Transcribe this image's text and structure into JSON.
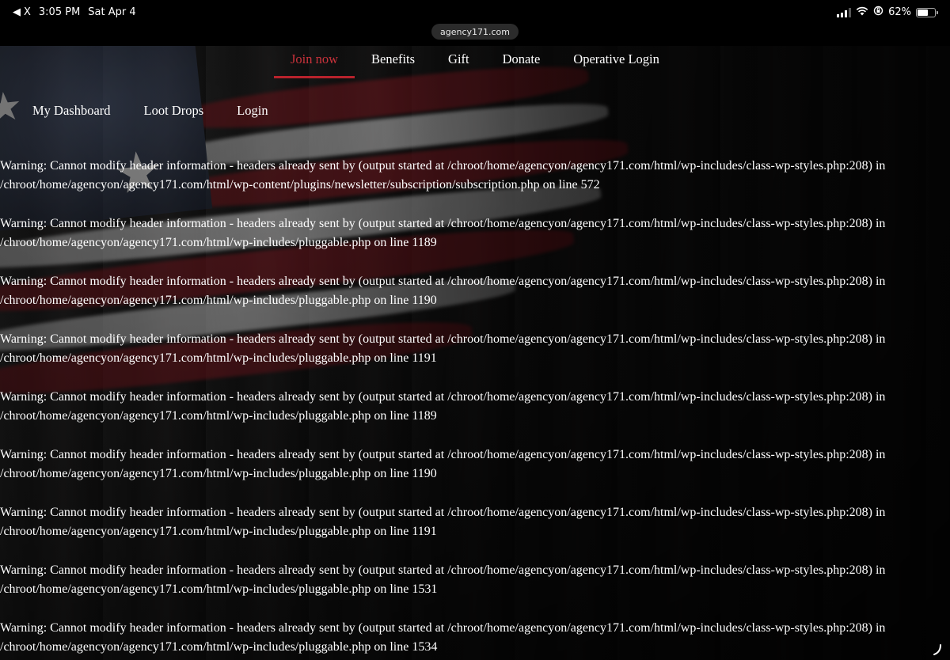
{
  "status_bar": {
    "back_label": "X",
    "time": "3:05 PM",
    "date": "Sat Apr 4",
    "battery": "62%",
    "battery_level": 0.62
  },
  "browser": {
    "url": "agency171.com"
  },
  "main_nav": [
    {
      "label": "Join now",
      "active": true
    },
    {
      "label": "Benefits",
      "active": false
    },
    {
      "label": "Gift",
      "active": false
    },
    {
      "label": "Donate",
      "active": false
    },
    {
      "label": "Operative Login",
      "active": false
    }
  ],
  "sub_nav": [
    {
      "label": "My Dashboard"
    },
    {
      "label": "Loot Drops"
    },
    {
      "label": "Login"
    }
  ],
  "colors": {
    "accent": "#c9323b",
    "text": "#ffffff",
    "background": "#000000"
  },
  "warnings": [
    {
      "line1": "Warning: Cannot modify header information - headers already sent by (output started at /chroot/home/agencyon/agency171.com/html/wp-includes/class-wp-styles.php:208) in",
      "line2": "/chroot/home/agencyon/agency171.com/html/wp-content/plugins/newsletter/subscription/subscription.php on line 572"
    },
    {
      "line1": "Warning: Cannot modify header information - headers already sent by (output started at /chroot/home/agencyon/agency171.com/html/wp-includes/class-wp-styles.php:208) in",
      "line2": "/chroot/home/agencyon/agency171.com/html/wp-includes/pluggable.php on line 1189"
    },
    {
      "line1": "Warning: Cannot modify header information - headers already sent by (output started at /chroot/home/agencyon/agency171.com/html/wp-includes/class-wp-styles.php:208) in",
      "line2": "/chroot/home/agencyon/agency171.com/html/wp-includes/pluggable.php on line 1190"
    },
    {
      "line1": "Warning: Cannot modify header information - headers already sent by (output started at /chroot/home/agencyon/agency171.com/html/wp-includes/class-wp-styles.php:208) in",
      "line2": "/chroot/home/agencyon/agency171.com/html/wp-includes/pluggable.php on line 1191"
    },
    {
      "line1": "Warning: Cannot modify header information - headers already sent by (output started at /chroot/home/agencyon/agency171.com/html/wp-includes/class-wp-styles.php:208) in",
      "line2": "/chroot/home/agencyon/agency171.com/html/wp-includes/pluggable.php on line 1189"
    },
    {
      "line1": "Warning: Cannot modify header information - headers already sent by (output started at /chroot/home/agencyon/agency171.com/html/wp-includes/class-wp-styles.php:208) in",
      "line2": "/chroot/home/agencyon/agency171.com/html/wp-includes/pluggable.php on line 1190"
    },
    {
      "line1": "Warning: Cannot modify header information - headers already sent by (output started at /chroot/home/agencyon/agency171.com/html/wp-includes/class-wp-styles.php:208) in",
      "line2": "/chroot/home/agencyon/agency171.com/html/wp-includes/pluggable.php on line 1191"
    },
    {
      "line1": "Warning: Cannot modify header information - headers already sent by (output started at /chroot/home/agencyon/agency171.com/html/wp-includes/class-wp-styles.php:208) in",
      "line2": "/chroot/home/agencyon/agency171.com/html/wp-includes/pluggable.php on line 1531"
    },
    {
      "line1": "Warning: Cannot modify header information - headers already sent by (output started at /chroot/home/agencyon/agency171.com/html/wp-includes/class-wp-styles.php:208) in",
      "line2": "/chroot/home/agencyon/agency171.com/html/wp-includes/pluggable.php on line 1534"
    }
  ]
}
